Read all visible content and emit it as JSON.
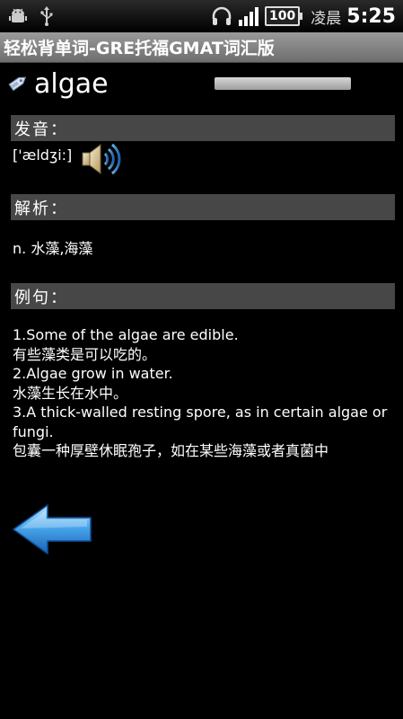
{
  "status_bar": {
    "icons": [
      "android-debug-icon",
      "usb-icon",
      "headset-icon",
      "signal-icon"
    ],
    "battery": "100",
    "period": "凌晨",
    "time": "5:25"
  },
  "app": {
    "title": "轻松背单词-GRE托福GMAT词汇版"
  },
  "word": {
    "text": "algae",
    "tag_icon": "tag-icon"
  },
  "pronunciation": {
    "header": "发音：",
    "phonetic": "['ældʒi:]",
    "speaker_icon": "speaker-icon"
  },
  "definition": {
    "header": "解析：",
    "text": "n. 水藻,海藻"
  },
  "examples": {
    "header": "例句：",
    "lines": [
      "1.Some of the algae are edible.",
      "有些藻类是可以吃的。",
      "2.Algae grow in water.",
      "水藻生长在水中。",
      "3.A thick-walled resting spore, as in certain algae or fungi.",
      "包囊一种厚壁休眠孢子，如在某些海藻或者真菌中"
    ]
  },
  "nav": {
    "back_icon": "back-arrow-icon"
  }
}
